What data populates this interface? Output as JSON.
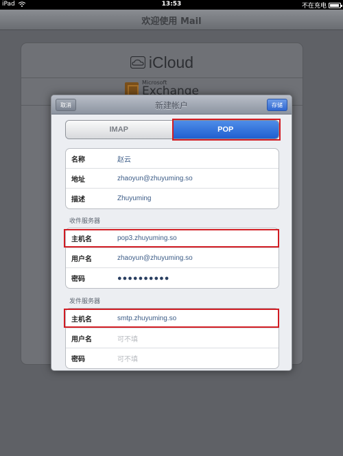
{
  "status_bar": {
    "device": "iPad",
    "time": "13:53",
    "charging": "不在充电"
  },
  "background_app": {
    "title": "欢迎使用 Mail",
    "providers": [
      {
        "name": "iCloud",
        "icon": "cloud-icon"
      },
      {
        "name_small": "Microsoft",
        "name_big": "Exchange",
        "icon": "exchange-icon"
      }
    ]
  },
  "modal": {
    "title": "新建帐户",
    "cancel_label": "取消",
    "save_label": "存储",
    "protocol_tabs": [
      {
        "label": "IMAP",
        "selected": false
      },
      {
        "label": "POP",
        "selected": true
      }
    ],
    "account": {
      "rows": [
        {
          "label": "名称",
          "value": "赵云"
        },
        {
          "label": "地址",
          "value": "zhaoyun@zhuyuming.so"
        },
        {
          "label": "描述",
          "value": "Zhuyuming"
        }
      ]
    },
    "incoming": {
      "header": "收件服务器",
      "rows": [
        {
          "label": "主机名",
          "value": "pop3.zhuyuming.so"
        },
        {
          "label": "用户名",
          "value": "zhaoyun@zhuyuming.so"
        },
        {
          "label": "密码",
          "value": "●●●●●●●●●●"
        }
      ]
    },
    "outgoing": {
      "header": "发件服务器",
      "rows": [
        {
          "label": "主机名",
          "value": "smtp.zhuyuming.so"
        },
        {
          "label": "用户名",
          "placeholder": "可不填"
        },
        {
          "label": "密码",
          "placeholder": "可不填"
        }
      ]
    }
  },
  "colors": {
    "highlight": "#d11b22",
    "selected_tab": "#1f5fd0",
    "save_button": "#2f67d2"
  }
}
